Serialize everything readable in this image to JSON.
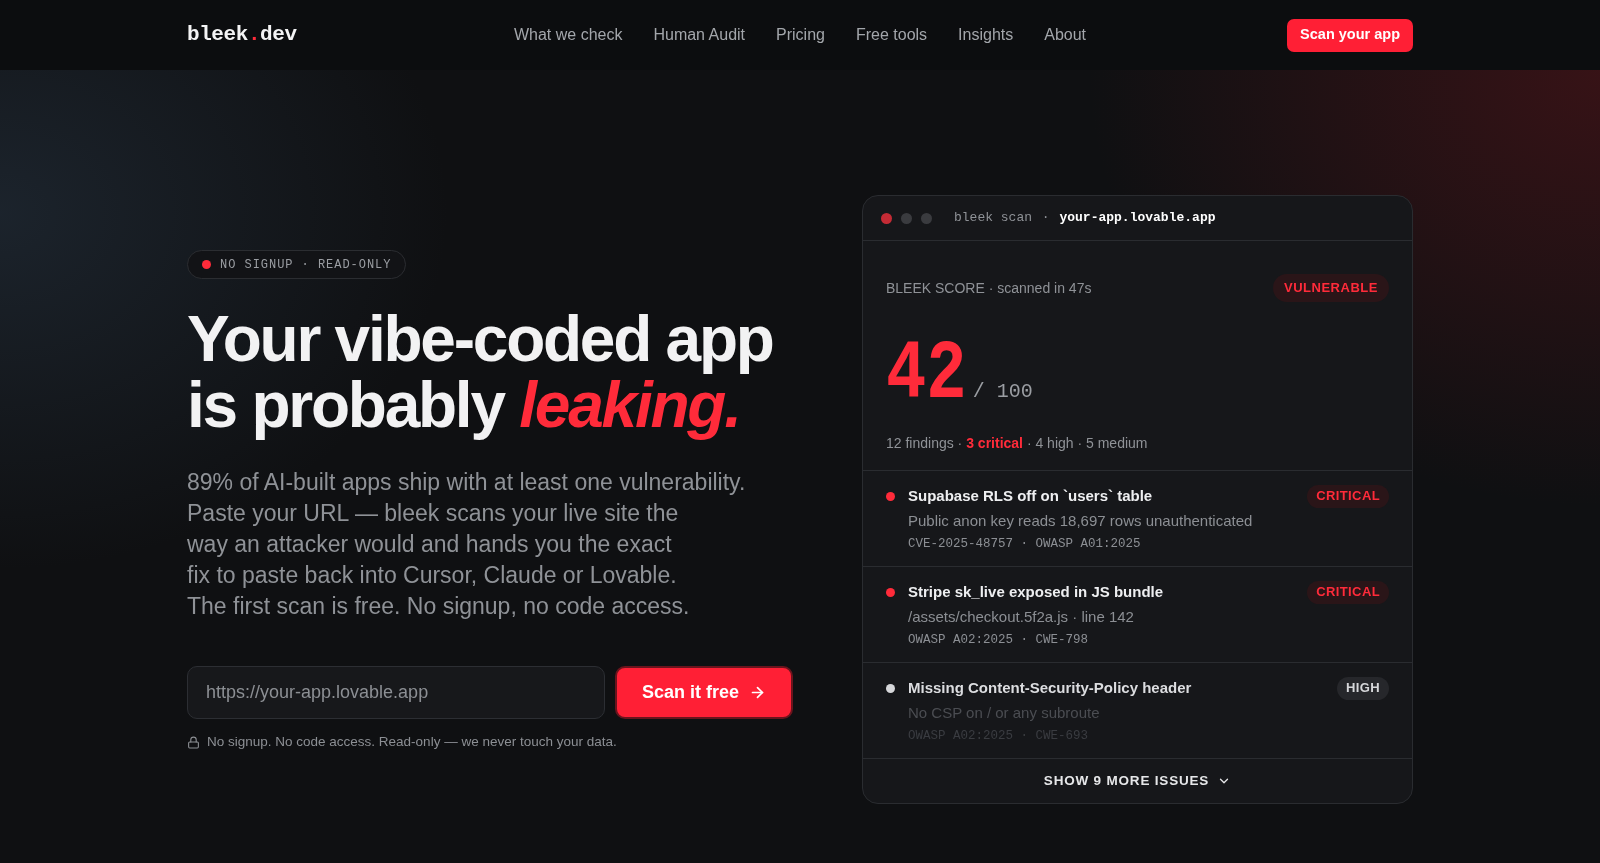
{
  "nav": {
    "logo": {
      "name": "bleek",
      "dot": ".",
      "tld": "dev"
    },
    "links": [
      "What we check",
      "Human Audit",
      "Pricing",
      "Free tools",
      "Insights",
      "About"
    ],
    "cta": "Scan your app"
  },
  "hero": {
    "badge": "NO SIGNUP · READ-ONLY",
    "headline": "Your vibe-coded app is probably *leaking.*",
    "lead": "89% of AI-built apps ship with at least one vulnerability.",
    "description": "Paste your URL — bleek scans your live site the way an attacker would and hands you the exact fix to paste back into Cursor, Claude or Lovable. The first scan is free. No signup, no code access.",
    "url_field": {
      "placeholder": "https://your-app.lovable.app"
    },
    "submit": "Scan it free",
    "note": "No signup. No code access. Read-only — we never touch your data."
  },
  "scan_card": {
    "title": {
      "command": "bleek scan",
      "separator": "·",
      "target": "your-app.lovable.app"
    },
    "score_label": "BLEEK SCORE · scanned in 47s",
    "verdict": "VULNERABLE",
    "score": "42",
    "score_max": "/ 100",
    "summary": [
      {
        "text": "12 findings · ",
        "highlight": false
      },
      {
        "text": "3 critical",
        "highlight": true
      },
      {
        "text": " · 4 high · 5 medium",
        "highlight": false
      }
    ],
    "issues": [
      {
        "kind": "critical",
        "title": "Supabase RLS off on `users` table",
        "detail": "Public anon key reads 18,697 rows unauthenticated",
        "refs": "CVE-2025-48757 · OWASP A01:2025",
        "severity": "CRITICAL"
      },
      {
        "kind": "critical",
        "title": "Stripe sk_live exposed in JS bundle",
        "detail": "/assets/checkout.5f2a.js · line 142",
        "refs": "OWASP A02:2025 · CWE-798",
        "severity": "CRITICAL"
      },
      {
        "kind": "high",
        "title": "Missing Content-Security-Policy header",
        "detail": "No CSP on / or any subroute",
        "refs": "OWASP A02:2025 · CWE-693",
        "severity": "HIGH"
      }
    ],
    "collapsed": true,
    "show_more": "SHOW 9 MORE ISSUES"
  }
}
